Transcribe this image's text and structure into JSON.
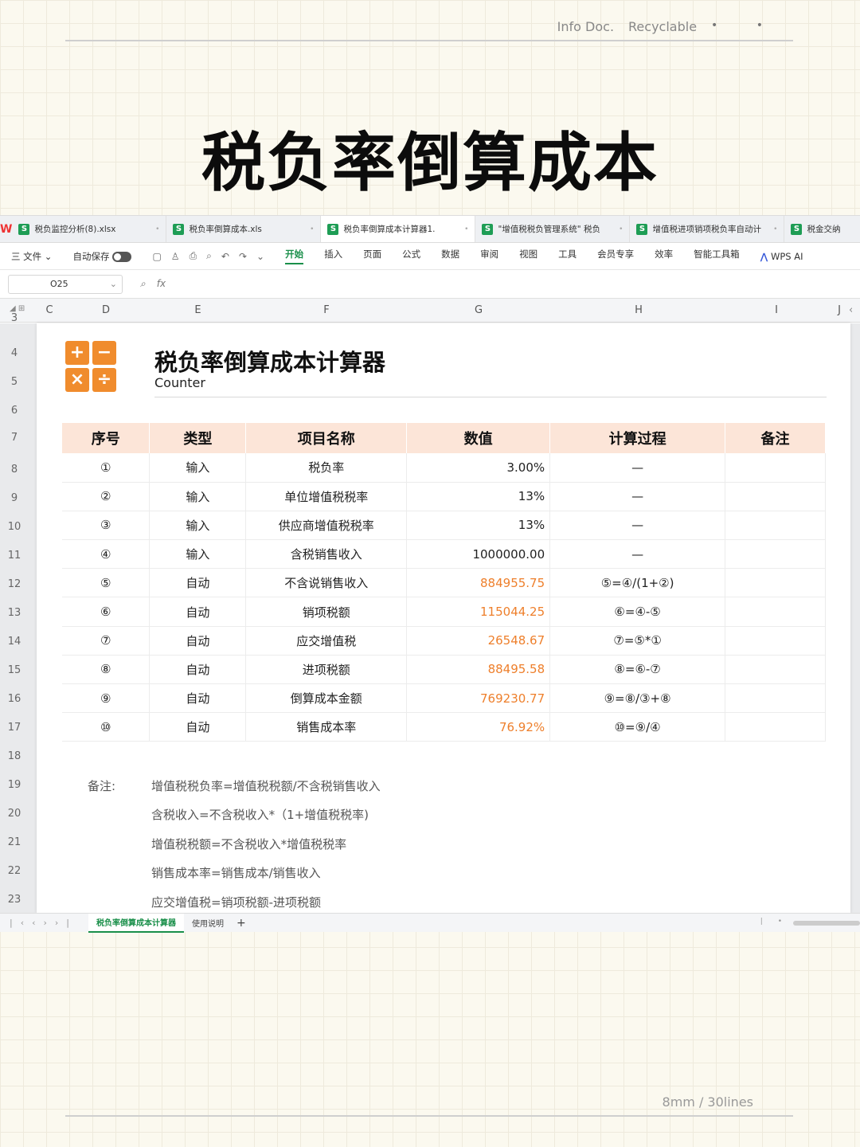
{
  "page": {
    "meta_left": "Info Doc.",
    "meta_right": "Recyclable",
    "meta_dots": "• •",
    "title": "税负率倒算成本",
    "footer": "8mm / 30lines"
  },
  "app": {
    "logo": "W",
    "file_tabs": [
      {
        "label": "税负监控分析(8).xlsx",
        "close": "•"
      },
      {
        "label": "税负率倒算成本.xls",
        "close": "•"
      },
      {
        "label": "税负率倒算成本计算器1.",
        "close": "•"
      },
      {
        "label": "\"增值税税负管理系统\" 税负",
        "close": "•"
      },
      {
        "label": "增值税进项销项税负率自动计",
        "close": "•"
      },
      {
        "label": "税金交纳",
        "close": ""
      }
    ],
    "file_icon_letter": "S",
    "menu": {
      "file": "三 文件 ⌄",
      "autosave": "自动保存",
      "items": [
        "开始",
        "插入",
        "页面",
        "公式",
        "数据",
        "审阅",
        "视图",
        "工具",
        "会员专享",
        "效率",
        "智能工具箱"
      ],
      "ai": "WPS AI",
      "toolbar_icons": [
        "save-icon",
        "share-icon",
        "print-icon",
        "preview-icon",
        "undo-icon",
        "redo-icon",
        "more-icon"
      ]
    },
    "namebox": "O25",
    "fx": "fx",
    "columns": [
      "C",
      "D",
      "E",
      "F",
      "G",
      "H",
      "I",
      "J"
    ],
    "rows": [
      "3",
      "4",
      "5",
      "6",
      "7",
      "8",
      "9",
      "10",
      "11",
      "12",
      "13",
      "14",
      "15",
      "16",
      "17",
      "18",
      "19",
      "20",
      "21",
      "22",
      "23"
    ],
    "sheet_tabs": [
      "税负率倒算成本计算器",
      "使用说明"
    ],
    "plus": "+"
  },
  "calc": {
    "logo": [
      "+",
      "−",
      "×",
      "÷"
    ],
    "title": "税负率倒算成本计算器",
    "subtitle": "Counter",
    "headers": [
      "序号",
      "类型",
      "项目名称",
      "数值",
      "计算过程",
      "备注"
    ],
    "rows": [
      {
        "no": "①",
        "type": "输入",
        "name": "税负率",
        "value": "3.00%",
        "proc": "—",
        "auto": false
      },
      {
        "no": "②",
        "type": "输入",
        "name": "单位增值税税率",
        "value": "13%",
        "proc": "—",
        "auto": false
      },
      {
        "no": "③",
        "type": "输入",
        "name": "供应商增值税税率",
        "value": "13%",
        "proc": "—",
        "auto": false
      },
      {
        "no": "④",
        "type": "输入",
        "name": "含税销售收入",
        "value": "1000000.00",
        "proc": "—",
        "auto": false
      },
      {
        "no": "⑤",
        "type": "自动",
        "name": "不含说销售收入",
        "value": "884955.75",
        "proc": "⑤=④/(1+②)",
        "auto": true
      },
      {
        "no": "⑥",
        "type": "自动",
        "name": "销项税额",
        "value": "115044.25",
        "proc": "⑥=④-⑤",
        "auto": true
      },
      {
        "no": "⑦",
        "type": "自动",
        "name": "应交增值税",
        "value": "26548.67",
        "proc": "⑦=⑤*①",
        "auto": true
      },
      {
        "no": "⑧",
        "type": "自动",
        "name": "进项税额",
        "value": "88495.58",
        "proc": "⑧=⑥-⑦",
        "auto": true
      },
      {
        "no": "⑨",
        "type": "自动",
        "name": "倒算成本金额",
        "value": "769230.77",
        "proc": "⑨=⑧/③+⑧",
        "auto": true
      },
      {
        "no": "⑩",
        "type": "自动",
        "name": "销售成本率",
        "value": "76.92%",
        "proc": "⑩=⑨/④",
        "auto": true
      }
    ],
    "notes_label": "备注:",
    "notes": [
      "增值税税负率=增值税税额/不含税销售收入",
      "含税收入=不含税收入*（1+增值税税率)",
      "增值税税额=不含税收入*增值税税率",
      "销售成本率=销售成本/销售收入",
      "应交增值税=销项税额-进项税额"
    ],
    "accent": "#ee7f2b",
    "header_bg": "#fce5d8"
  }
}
